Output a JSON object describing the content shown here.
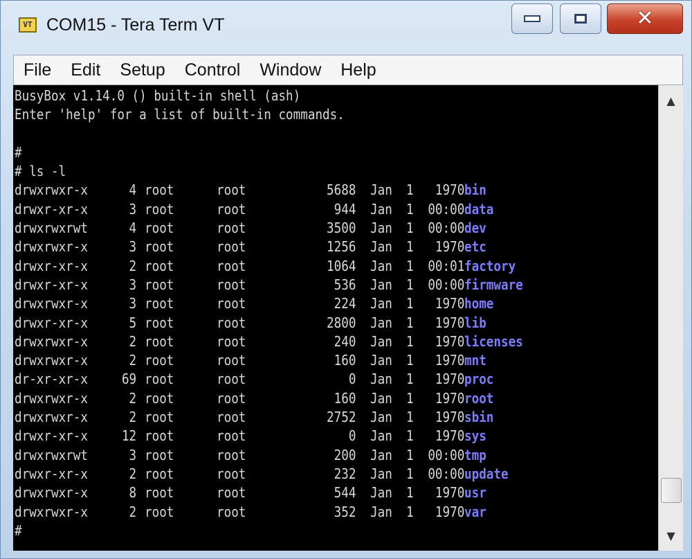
{
  "window": {
    "title": "COM15 - Tera Term VT",
    "icon": "tera-term-app-icon",
    "icon_text": "VT",
    "controls": [
      "minimize-icon",
      "maximize-icon",
      "close-icon"
    ]
  },
  "menu": [
    "File",
    "Edit",
    "Setup",
    "Control",
    "Window",
    "Help"
  ],
  "terminal": {
    "banner": [
      "BusyBox v1.14.0 () built-in shell (ash)",
      "Enter 'help' for a list of built-in commands."
    ],
    "blank": "",
    "prompt1": "#",
    "command": "# ls -l",
    "listing": [
      {
        "perm": "drwxrwxr-x",
        "links": "4",
        "owner": "root",
        "group": "root",
        "size": "5688",
        "month": "Jan",
        "day": "1",
        "time": "1970",
        "name": "bin"
      },
      {
        "perm": "drwxr-xr-x",
        "links": "3",
        "owner": "root",
        "group": "root",
        "size": "944",
        "month": "Jan",
        "day": "1",
        "time": "00:00",
        "name": "data"
      },
      {
        "perm": "drwxrwxrwt",
        "links": "4",
        "owner": "root",
        "group": "root",
        "size": "3500",
        "month": "Jan",
        "day": "1",
        "time": "00:00",
        "name": "dev"
      },
      {
        "perm": "drwxrwxr-x",
        "links": "3",
        "owner": "root",
        "group": "root",
        "size": "1256",
        "month": "Jan",
        "day": "1",
        "time": "1970",
        "name": "etc"
      },
      {
        "perm": "drwxr-xr-x",
        "links": "2",
        "owner": "root",
        "group": "root",
        "size": "1064",
        "month": "Jan",
        "day": "1",
        "time": "00:01",
        "name": "factory"
      },
      {
        "perm": "drwxr-xr-x",
        "links": "3",
        "owner": "root",
        "group": "root",
        "size": "536",
        "month": "Jan",
        "day": "1",
        "time": "00:00",
        "name": "firmware"
      },
      {
        "perm": "drwxrwxr-x",
        "links": "3",
        "owner": "root",
        "group": "root",
        "size": "224",
        "month": "Jan",
        "day": "1",
        "time": "1970",
        "name": "home"
      },
      {
        "perm": "drwxr-xr-x",
        "links": "5",
        "owner": "root",
        "group": "root",
        "size": "2800",
        "month": "Jan",
        "day": "1",
        "time": "1970",
        "name": "lib"
      },
      {
        "perm": "drwxrwxr-x",
        "links": "2",
        "owner": "root",
        "group": "root",
        "size": "240",
        "month": "Jan",
        "day": "1",
        "time": "1970",
        "name": "licenses"
      },
      {
        "perm": "drwxrwxr-x",
        "links": "2",
        "owner": "root",
        "group": "root",
        "size": "160",
        "month": "Jan",
        "day": "1",
        "time": "1970",
        "name": "mnt"
      },
      {
        "perm": "dr-xr-xr-x",
        "links": "69",
        "owner": "root",
        "group": "root",
        "size": "0",
        "month": "Jan",
        "day": "1",
        "time": "1970",
        "name": "proc"
      },
      {
        "perm": "drwxrwxr-x",
        "links": "2",
        "owner": "root",
        "group": "root",
        "size": "160",
        "month": "Jan",
        "day": "1",
        "time": "1970",
        "name": "root"
      },
      {
        "perm": "drwxrwxr-x",
        "links": "2",
        "owner": "root",
        "group": "root",
        "size": "2752",
        "month": "Jan",
        "day": "1",
        "time": "1970",
        "name": "sbin"
      },
      {
        "perm": "drwxr-xr-x",
        "links": "12",
        "owner": "root",
        "group": "root",
        "size": "0",
        "month": "Jan",
        "day": "1",
        "time": "1970",
        "name": "sys"
      },
      {
        "perm": "drwxrwxrwt",
        "links": "3",
        "owner": "root",
        "group": "root",
        "size": "200",
        "month": "Jan",
        "day": "1",
        "time": "00:00",
        "name": "tmp"
      },
      {
        "perm": "drwxr-xr-x",
        "links": "2",
        "owner": "root",
        "group": "root",
        "size": "232",
        "month": "Jan",
        "day": "1",
        "time": "00:00",
        "name": "update"
      },
      {
        "perm": "drwxrwxr-x",
        "links": "8",
        "owner": "root",
        "group": "root",
        "size": "544",
        "month": "Jan",
        "day": "1",
        "time": "1970",
        "name": "usr"
      },
      {
        "perm": "drwxrwxr-x",
        "links": "2",
        "owner": "root",
        "group": "root",
        "size": "352",
        "month": "Jan",
        "day": "1",
        "time": "1970",
        "name": "var"
      }
    ],
    "prompt_last": "#"
  },
  "scrollbar": {
    "up_icon": "scroll-up-arrow-icon",
    "down_icon": "scroll-down-arrow-icon",
    "position": 0.95
  },
  "colors": {
    "terminal_bg": "#000000",
    "terminal_fg": "#d8d8d8",
    "directory_name": "#7d7dff",
    "close_button": "#c9432a"
  }
}
